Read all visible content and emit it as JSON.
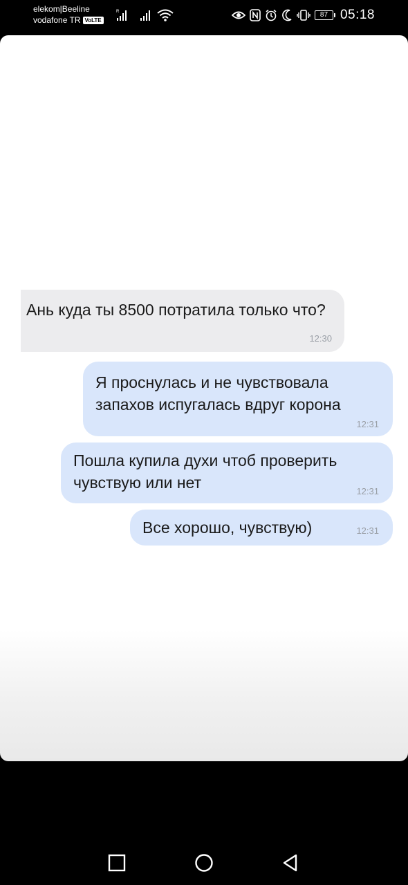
{
  "status_bar": {
    "carrier_1": "elekom|Beeline",
    "carrier_2": "vodafone TR",
    "volte_badge": "VoLTE",
    "battery_level": "87",
    "time": "05:18",
    "icons": [
      "signal-icon",
      "wifi-icon",
      "eye-icon",
      "nfc-icon",
      "alarm-icon",
      "moon-icon",
      "vibrate-icon",
      "battery-icon"
    ]
  },
  "chat": {
    "messages": [
      {
        "direction": "incoming",
        "text": "Ань куда ты 8500 потратила только что?",
        "time": "12:30"
      },
      {
        "direction": "outgoing",
        "text": "Я проснулась и не чувствовала запахов испугалась вдруг корона",
        "time": "12:31"
      },
      {
        "direction": "outgoing",
        "text": "Пошла купила духи чтоб проверить чувствую или нет",
        "time": "12:31"
      },
      {
        "direction": "outgoing",
        "text": "Все хорошо, чувствую)",
        "time": "12:31"
      }
    ],
    "colors": {
      "incoming_bubble": "#ececee",
      "outgoing_bubble": "#d9e6fb",
      "timestamp": "#9a9fa6"
    }
  },
  "nav_bar": {
    "buttons": [
      "recent-apps-icon",
      "home-icon",
      "back-icon"
    ]
  }
}
